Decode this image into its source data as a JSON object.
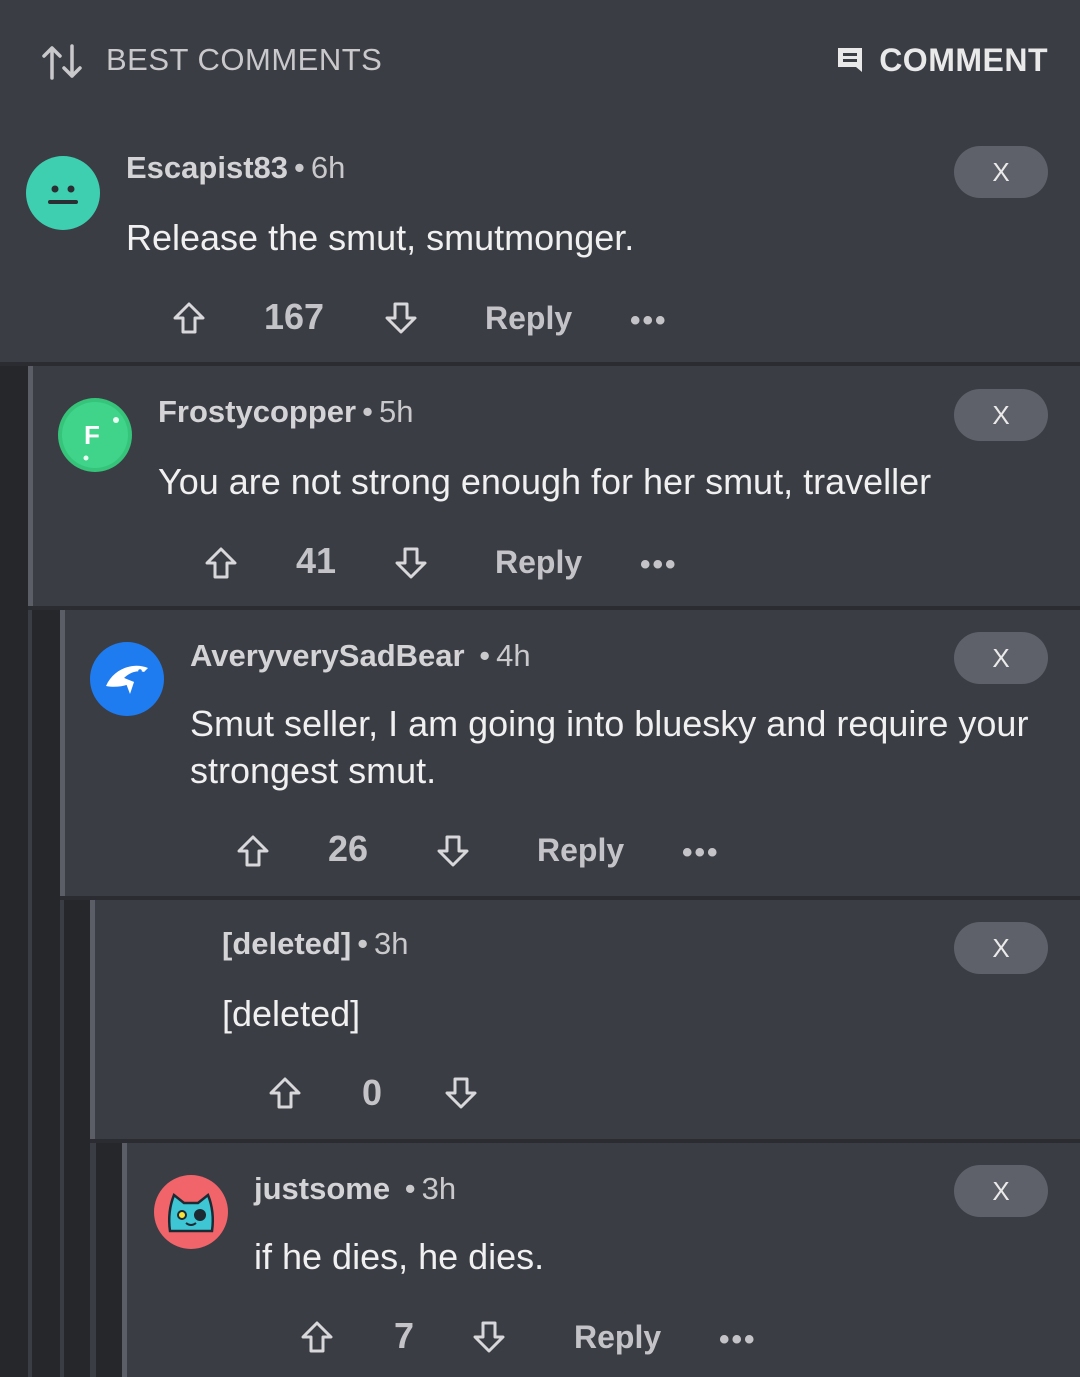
{
  "header": {
    "sort_label": "BEST COMMENTS",
    "comment_button_label": "COMMENT"
  },
  "comments": [
    {
      "user": "Escapist83",
      "age": "6h",
      "text": "Release the smut, smutmonger.",
      "score": "167",
      "reply_label": "Reply",
      "more": "•••",
      "close": "X",
      "avatar_color": "#3ecfb0"
    },
    {
      "user": "Frostycopper",
      "age": "5h",
      "text": "You are not strong enough for her smut, traveller",
      "score": "41",
      "reply_label": "Reply",
      "more": "•••",
      "close": "X",
      "avatar_color": "#35c47a",
      "avatar_letter": "F"
    },
    {
      "user": "AveryverySadBear",
      "age": "4h",
      "text": "Smut seller, I am going into bluesky and require your strongest smut.",
      "score": "26",
      "reply_label": "Reply",
      "more": "•••",
      "close": "X",
      "avatar_color": "#1e7cf0"
    },
    {
      "user": "[deleted]",
      "age": "3h",
      "text": "[deleted]",
      "score": "0",
      "close": "X"
    },
    {
      "user": "justsome",
      "age": "3h",
      "text": "if he dies, he dies.",
      "score": "7",
      "reply_label": "Reply",
      "more": "•••",
      "close": "X",
      "avatar_color": "#f0646a"
    }
  ]
}
